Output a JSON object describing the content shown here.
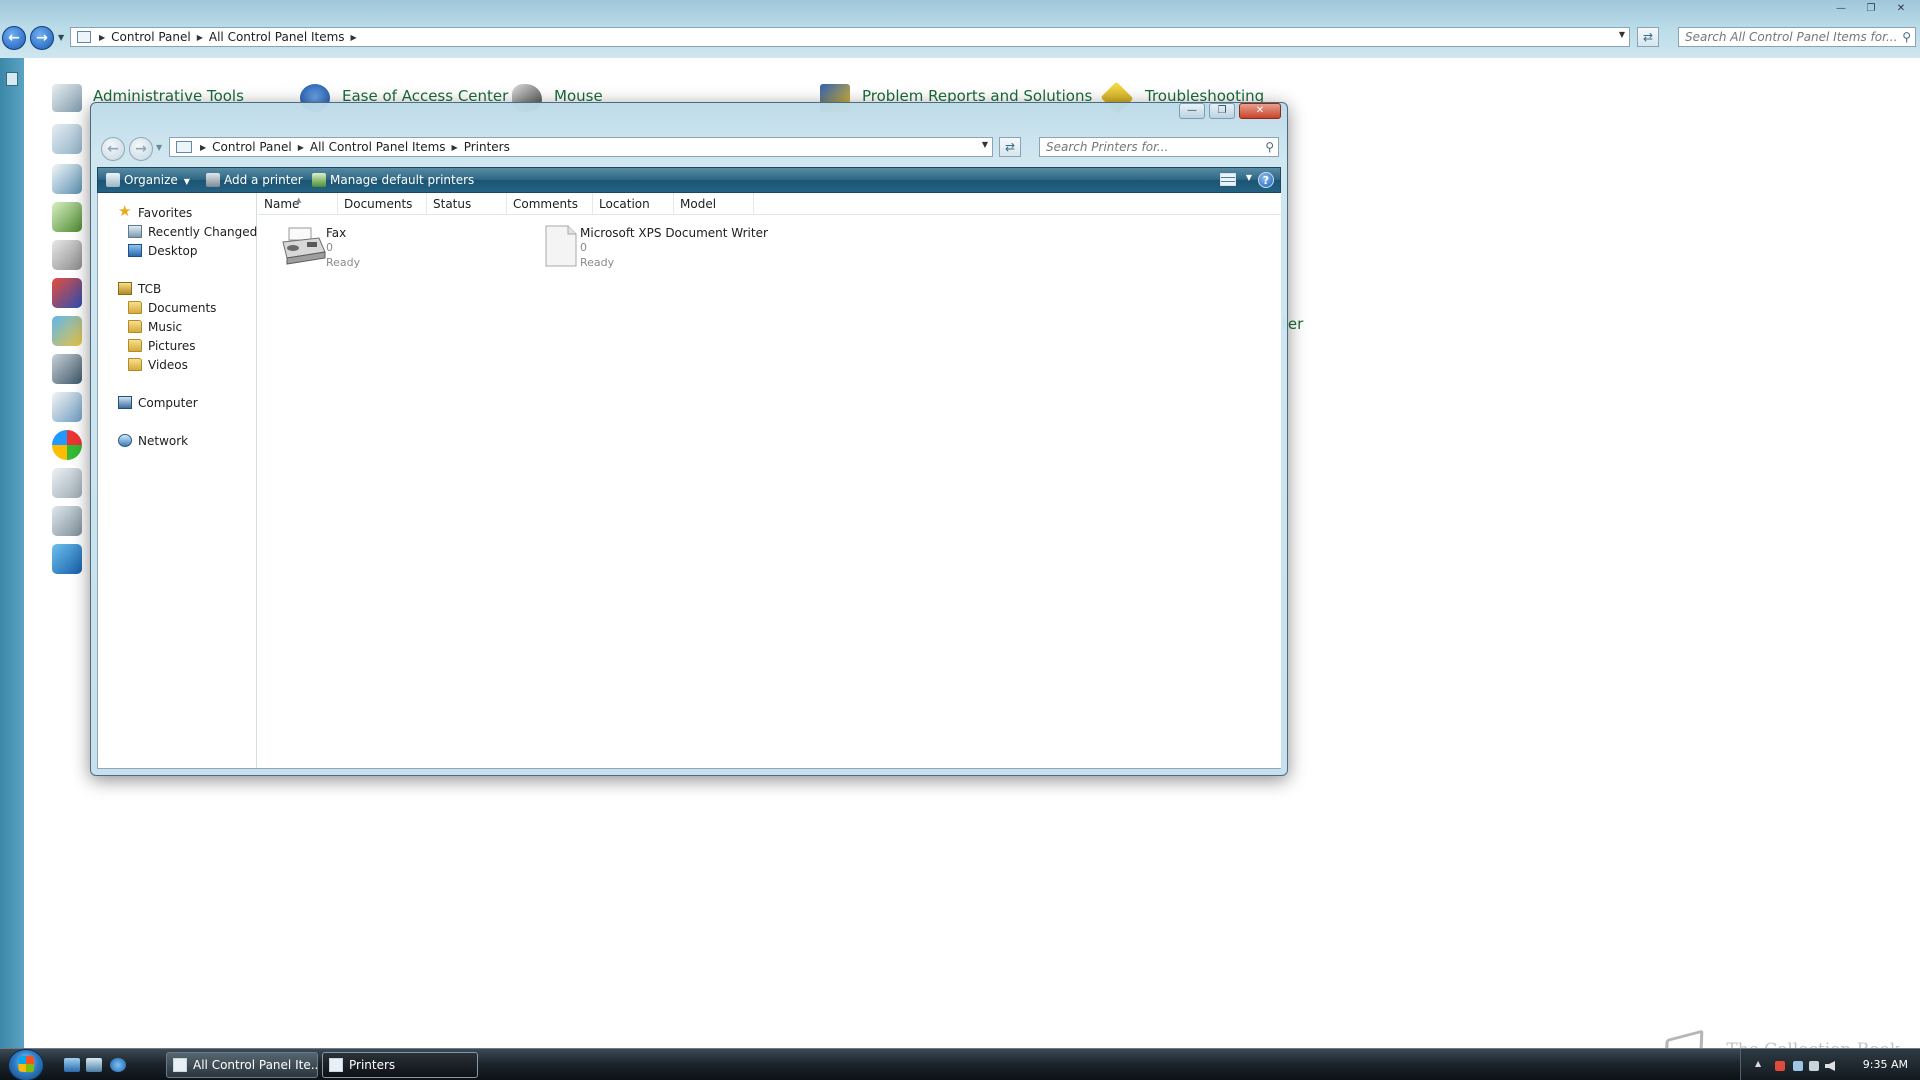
{
  "background_window": {
    "breadcrumb": [
      "Control Panel",
      "All Control Panel Items"
    ],
    "search_placeholder": "Search All Control Panel Items for...",
    "items_row1": [
      {
        "label": "Administrative Tools",
        "icon": "administrative-tools-icon"
      },
      {
        "label": "Ease of Access Center",
        "icon": "ease-of-access-icon"
      },
      {
        "label": "Mouse",
        "icon": "mouse-icon"
      },
      {
        "label": "Problem Reports and Solutions",
        "icon": "problem-reports-icon"
      },
      {
        "label": "Troubleshooting",
        "icon": "troubleshooting-icon"
      }
    ],
    "partial_text": "ter"
  },
  "printers_window": {
    "breadcrumb": [
      "Control Panel",
      "All Control Panel Items",
      "Printers"
    ],
    "search_placeholder": "Search Printers for...",
    "toolbar": {
      "organize": "Organize",
      "add_printer": "Add a printer",
      "manage_default": "Manage default printers",
      "help": "?"
    },
    "nav": {
      "favorites": "Favorites",
      "favorites_items": [
        "Recently Changed",
        "Desktop"
      ],
      "user": "TCB",
      "user_items": [
        "Documents",
        "Music",
        "Pictures",
        "Videos"
      ],
      "computer": "Computer",
      "network": "Network"
    },
    "columns": [
      "Name",
      "Documents",
      "Status",
      "Comments",
      "Location",
      "Model"
    ],
    "printers": [
      {
        "name": "Fax",
        "documents": "0",
        "status": "Ready",
        "icon": "fax-printer-icon"
      },
      {
        "name": "Microsoft XPS Document Writer",
        "documents": "0",
        "status": "Ready",
        "icon": "document-printer-icon"
      }
    ]
  },
  "taskbar": {
    "buttons": [
      "All Control Panel Ite...",
      "Printers"
    ],
    "clock": "9:35 AM"
  },
  "watermark": "The Collection Book",
  "colors": {
    "link_green": "#1a6b3a",
    "toolbar_blue": "#2d6784",
    "window_glass": "#c4e0ec"
  }
}
